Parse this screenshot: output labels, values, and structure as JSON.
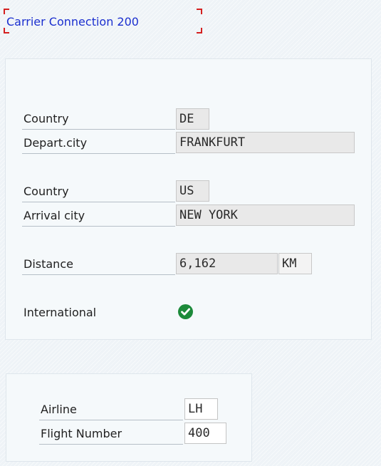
{
  "title": "Carrier Connection 200",
  "departure": {
    "country_label": "Country",
    "country_value": "DE",
    "city_label": "Depart.city",
    "city_value": "FRANKFURT"
  },
  "arrival": {
    "country_label": "Country",
    "country_value": "US",
    "city_label": "Arrival city",
    "city_value": "NEW YORK"
  },
  "distance": {
    "label": "Distance",
    "value": "6,162",
    "unit": "KM"
  },
  "international": {
    "label": "International",
    "checked": true,
    "icon": "checkmark-circle-icon",
    "color": "#1c8a3a"
  },
  "flight": {
    "airline_label": "Airline",
    "airline_value": "LH",
    "number_label": "Flight Number",
    "number_value": "400"
  },
  "colors": {
    "title_text": "#1b2fcf",
    "title_marker": "#d42020"
  }
}
